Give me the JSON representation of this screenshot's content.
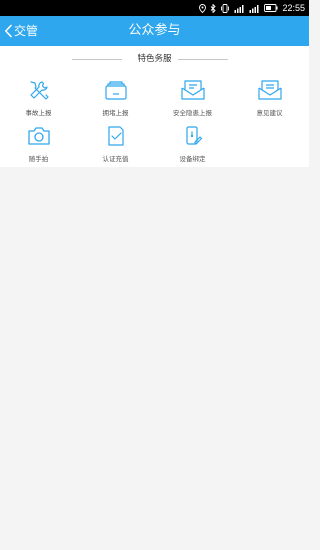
{
  "status_bar": {
    "time": "22:55",
    "icons": [
      "location-icon",
      "bluetooth-icon",
      "vibrate-icon",
      "signal-4g-icon",
      "signal-icon",
      "battery-icon"
    ]
  },
  "nav": {
    "back_label": "交管",
    "title": "公众参与",
    "accent_color": "#2fa7ee"
  },
  "section": {
    "title": "特色务服"
  },
  "services": [
    {
      "label": "事故上报",
      "icon": "tools-icon"
    },
    {
      "label": "拥堵上报",
      "icon": "layers-icon"
    },
    {
      "label": "安全隐患上报",
      "icon": "mail-icon"
    },
    {
      "label": "意见建议",
      "icon": "envelope-icon"
    },
    {
      "label": "随手拍",
      "icon": "camera-icon"
    },
    {
      "label": "认证充值",
      "icon": "verified-doc-icon"
    },
    {
      "label": "设备绑定",
      "icon": "device-bind-icon"
    }
  ],
  "icon_color": "#2fa7ee"
}
